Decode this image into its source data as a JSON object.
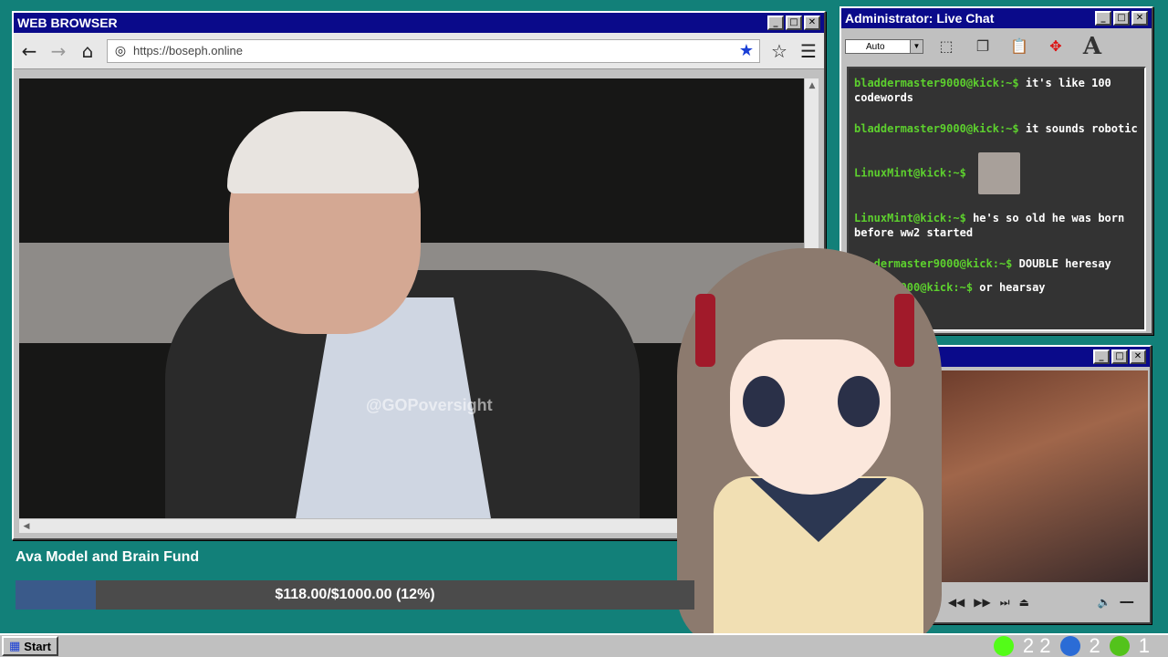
{
  "browser": {
    "title": "WEB BROWSER",
    "url": "https://boseph.online",
    "watermark": "@GOPoversight",
    "icons": [
      "back-arrow-icon",
      "forward-arrow-icon",
      "home-icon",
      "globe-icon",
      "bookmark-star-icon",
      "favorite-star-icon",
      "hamburger-menu-icon"
    ]
  },
  "chat": {
    "title": "Administrator: Live Chat",
    "font_select": "Auto",
    "messages": [
      {
        "user": "bladdermaster9000@kick:~$",
        "text": "it's like 100 codewords"
      },
      {
        "user": "bladdermaster9000@kick:~$",
        "text": "it sounds robotic"
      },
      {
        "user": "LinuxMint@kick:~$",
        "text": ""
      },
      {
        "user": "LinuxMint@kick:~$",
        "text": "he's so old he was born before ww2 started"
      },
      {
        "user": "...dermaster9000@kick:~$",
        "text": "DOUBLE heresay"
      },
      {
        "user": "...ter9000@kick:~$",
        "text": "or hearsay"
      }
    ]
  },
  "fund": {
    "title": "Ava Model and Brain Fund",
    "amount_text": "$118.00/$1000.00 (12%)",
    "progress": 0.118
  },
  "taskbar": {
    "start_label": "Start",
    "tray": [
      {
        "icon": "kick-icon",
        "count": "2 2"
      },
      {
        "icon": "moon-icon",
        "count": "2"
      },
      {
        "icon": "play-icon",
        "count": "1"
      }
    ]
  },
  "colors": {
    "desktop": "#128079",
    "titlebar": "#0a0a8a",
    "chat_user": "#5dd02e",
    "fund_fill": "#3a5a8a"
  }
}
